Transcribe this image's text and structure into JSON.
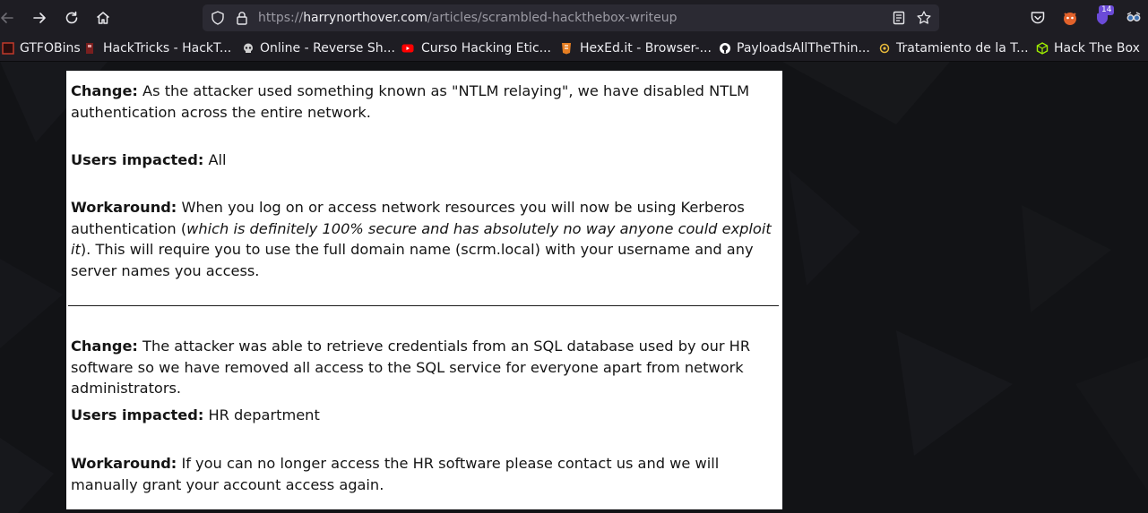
{
  "browser": {
    "url_prefix": "https://",
    "url_domain": "harrynorthover.com",
    "url_path": "/articles/scrambled-hackthebox-writeup",
    "extension_badge": "14"
  },
  "bookmarks": [
    {
      "label": "GTFOBins",
      "icon": "gtfobins-icon",
      "color": "#c0392b"
    },
    {
      "label": "HackTricks - HackT...",
      "icon": "hacktricks-icon",
      "color": "#a83232"
    },
    {
      "label": "Online - Reverse Sh...",
      "icon": "skull-icon",
      "color": "#d0d0d0"
    },
    {
      "label": "Curso Hacking Etic...",
      "icon": "youtube-icon",
      "color": "#ff0000"
    },
    {
      "label": "HexEd.it - Browser-...",
      "icon": "hexed-icon",
      "color": "#e67e22"
    },
    {
      "label": "PayloadsAllTheThin...",
      "icon": "github-icon",
      "color": "#ffffff"
    },
    {
      "label": "Tratamiento de la T...",
      "icon": "tratamiento-icon",
      "color": "#e5b83b"
    },
    {
      "label": "Hack The Box",
      "icon": "htb-cube-icon",
      "color": "#9fef00"
    }
  ],
  "article": {
    "sections": [
      {
        "change_label": "Change:",
        "change_text": " As the attacker used something known as \"NTLM relaying\", we have disabled NTLM authentication across the entire network.",
        "impacted_label": "Users impacted:",
        "impacted_text": " All",
        "workaround_label": "Workaround:",
        "workaround_text_1": " When you log on or access network resources you will now be using Kerberos authentication (",
        "workaround_italic": "which is definitely 100% secure and has absolutely no way anyone could exploit it",
        "workaround_text_2": "). This will require you to use the full domain name (scrm.local) with your username and any server names you access."
      },
      {
        "change_label": "Change:",
        "change_text": " The attacker was able to retrieve credentials from an SQL database used by our HR software so we have removed all access to the SQL service for everyone apart from network administrators.",
        "impacted_label": "Users impacted:",
        "impacted_text": " HR department",
        "workaround_label": "Workaround:",
        "workaround_text_1": " If you can no longer access the HR software please contact us and we will manually grant your account access again."
      }
    ]
  }
}
